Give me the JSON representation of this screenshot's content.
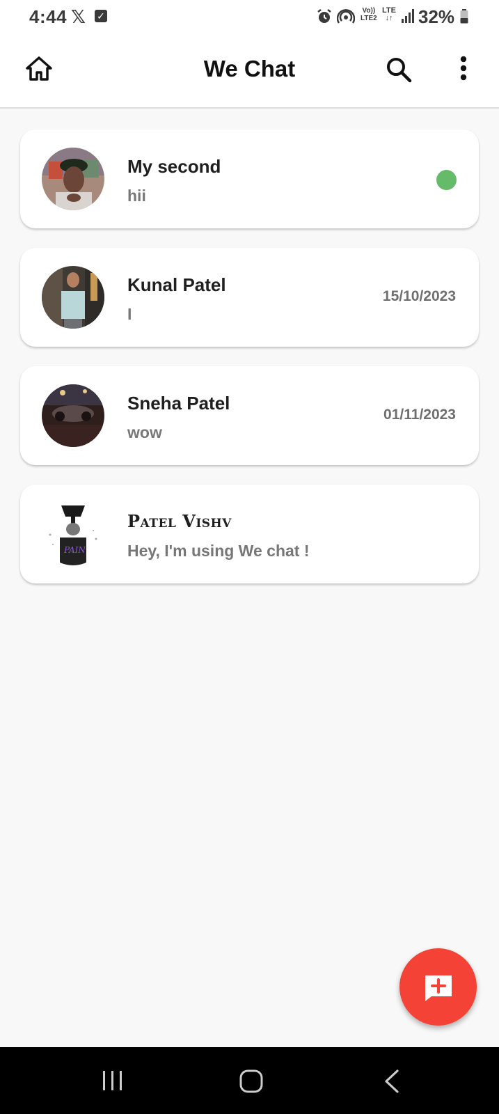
{
  "status_bar": {
    "time": "4:44",
    "x_icon": "x-logo-icon",
    "volte_top": "Vo))",
    "volte_bottom": "LTE2",
    "lte_top": "LTE",
    "lte_bottom": "↓↑",
    "battery_percent": "32%"
  },
  "app_bar": {
    "title": "We Chat",
    "home_icon": "home-icon",
    "search_icon": "search-icon",
    "more_icon": "more-vert-icon"
  },
  "chats": [
    {
      "name": "My second",
      "message": "hii",
      "date": "",
      "online": true,
      "avatar_color": "#8a6f63"
    },
    {
      "name": "Kunal Patel",
      "message": "I",
      "date": "15/10/2023",
      "online": false,
      "avatar_color": "#4a4540"
    },
    {
      "name": "Sneha Patel",
      "message": "wow",
      "date": "01/11/2023",
      "online": false,
      "avatar_color": "#2e1e1c"
    },
    {
      "name": "Patel Vishv",
      "message": "Hey, I'm using We chat !",
      "date": "",
      "online": false,
      "avatar_color": "#ffffff"
    }
  ],
  "fab": {
    "icon": "add-comment-icon",
    "color": "#f44336"
  },
  "colors": {
    "online": "#66bb6a",
    "background": "#f8f8f8"
  }
}
